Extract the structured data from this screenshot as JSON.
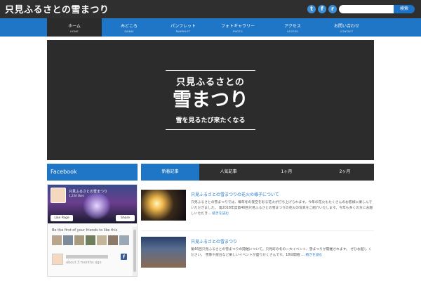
{
  "header": {
    "site_title": "只見ふるさとの雪まつり",
    "search_placeholder": "",
    "search_button": "検索",
    "social_icons": [
      "twitter-icon",
      "facebook-icon",
      "rss-icon"
    ]
  },
  "nav": {
    "items": [
      {
        "label": "ホーム",
        "sub": "HOME",
        "active": true
      },
      {
        "label": "みどころ",
        "sub": "SAIBAI",
        "active": false
      },
      {
        "label": "パンフレット",
        "sub": "PAMPHLET",
        "active": false
      },
      {
        "label": "フォトギャラリー",
        "sub": "PHOTO",
        "active": false
      },
      {
        "label": "アクセス",
        "sub": "ACCESS",
        "active": false
      },
      {
        "label": "お問い合わせ",
        "sub": "CONTACT",
        "active": false
      }
    ]
  },
  "hero": {
    "line1": "只見ふるさとの",
    "line2": "雪まつり",
    "line3": "雪を見るたび来たくなる"
  },
  "sidebar": {
    "facebook_title": "Facebook",
    "page_name": "只見ふるさとの雪まつり",
    "likes": "1,234 likes",
    "like_button": "Like Page",
    "share_button": "Share",
    "friends_text": "Be the first of your friends to like this",
    "post_time": "about 3 months ago"
  },
  "tabs": {
    "items": [
      "新着記事",
      "人気記事",
      "1ヶ月",
      "2ヶ月"
    ]
  },
  "articles": [
    {
      "title": "只見ふるさとの雪まつりの花火の様子について",
      "text": "只見ふるさとの雪まつりでは、毎年冬の夜空を彩る花火が打ち上げられます。今年の花火もたくさんのお客様に楽しんでいただきました。 第2018年度第46回只見ふるさとの雪まつりの花火の写真をご紹介いたします。今年も多くの方にお越しいただき…",
      "more": "続きを読む"
    },
    {
      "title": "只見ふるさとの雪まつり",
      "text": "第46回只見ふるさとの雪まつりの開催について。只見町の冬の一大イベント、雪まつりが開催されます。 ぜひお越し ください。 雪像や屋台など楽しいイベントが盛りだくさんです。18日開催 …",
      "more": "続きを読む"
    }
  ],
  "colors": {
    "accent": "#1f76c6",
    "dark": "#2f2f2f"
  }
}
